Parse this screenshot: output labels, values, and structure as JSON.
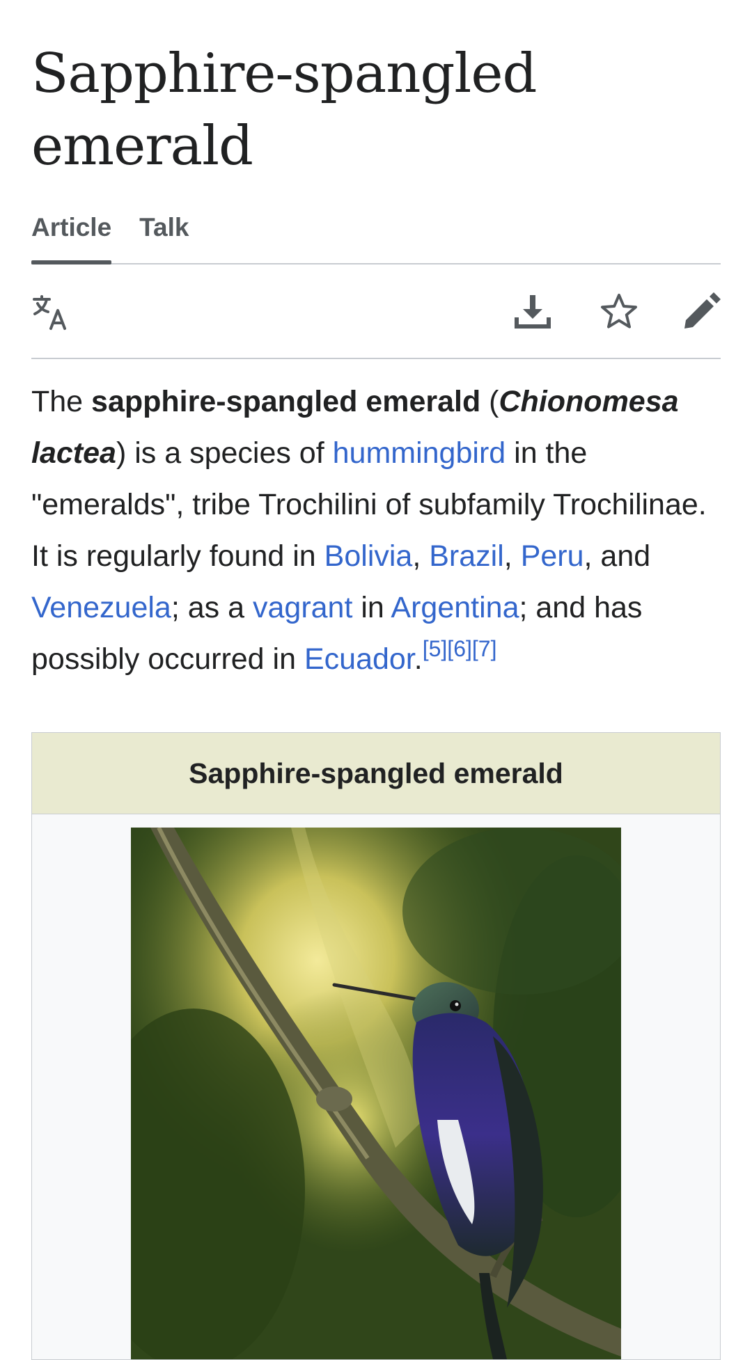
{
  "page": {
    "title": "Sapphire-spangled emerald"
  },
  "tabs": [
    {
      "label": "Article",
      "selected": true
    },
    {
      "label": "Talk",
      "selected": false
    }
  ],
  "toolbar": {
    "language_icon": "translate-icon",
    "download_icon": "download-icon",
    "watch_icon": "star-icon",
    "edit_icon": "pencil-icon"
  },
  "lead": {
    "t1": "The ",
    "b1": "sapphire-spangled emerald",
    "t2": " (",
    "bi1": "Chionomesa lactea",
    "t3": ") is a species of ",
    "l_hummingbird": "hummingbird",
    "t4": " in the \"emeralds\", tribe Trochilini of subfamily Trochilinae. It is regularly found in ",
    "l_bolivia": "Bolivia",
    "t5": ", ",
    "l_brazil": "Brazil",
    "t6": ", ",
    "l_peru": "Peru",
    "t7": ", and ",
    "l_venezuela": "Venezuela",
    "t8": "; as a ",
    "l_vagrant": "vagrant",
    "t9": " in ",
    "l_argentina": "Argentina",
    "t10": "; and has possibly occurred in ",
    "l_ecuador": "Ecuador",
    "t11": ".",
    "refs": "[5][6][7]"
  },
  "infobox": {
    "title": "Sapphire-spangled emerald"
  },
  "colors": {
    "link": "#3366cc",
    "text": "#202122",
    "icon": "#54595d",
    "infobox_header": "#e9ead0",
    "border": "#c8ccd1"
  }
}
